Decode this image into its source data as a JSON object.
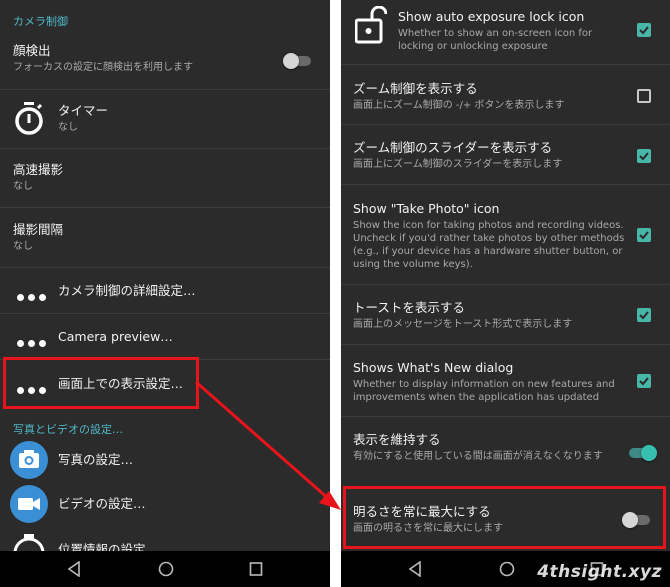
{
  "left": {
    "section_camera_control": "カメラ制御",
    "face_detect": {
      "title": "顔検出",
      "subtitle": "フォーカスの設定に顔検出を利用します",
      "enabled": false
    },
    "timer": {
      "title": "タイマー",
      "subtitle": "なし",
      "icon": "stopwatch-icon"
    },
    "burst": {
      "title": "高速撮影",
      "subtitle": "なし"
    },
    "interval": {
      "title": "撮影間隔",
      "subtitle": "なし"
    },
    "camera_advanced": {
      "title": "カメラ制御の詳細設定…",
      "icon": "more-dots-icon"
    },
    "camera_preview": {
      "title": "Camera preview…",
      "icon": "more-dots-icon"
    },
    "on_screen_gui": {
      "title": "画面上での表示設定…",
      "icon": "more-dots-icon"
    },
    "section_photo_video": "写真とビデオの設定…",
    "photo_settings": {
      "title": "写真の設定…",
      "icon": "camera-icon"
    },
    "video_settings": {
      "title": "ビデオの設定…",
      "icon": "video-camera-icon"
    },
    "location_settings": {
      "title": "位置情報の設定…",
      "icon": "location-icon"
    }
  },
  "right": {
    "auto_exposure_lock": {
      "title": "Show auto exposure lock icon",
      "subtitle": "Whether to show an on-screen icon for locking or unlocking exposure",
      "checked": true,
      "icon": "unlock-icon"
    },
    "zoom_controls": {
      "title": "ズーム制御を表示する",
      "subtitle": "画面上にズーム制御の -/+ ボタンを表示します",
      "checked": false
    },
    "zoom_slider": {
      "title": "ズーム制御のスライダーを表示する",
      "subtitle": "画面上にズーム制御のスライダーを表示します",
      "checked": true
    },
    "take_photo_icon": {
      "title": "Show \"Take Photo\" icon",
      "subtitle": "Show the icon for taking photos and recording videos. Uncheck if you'd rather take photos by other methods (e.g., if your device has a hardware shutter button, or using the volume keys).",
      "checked": true
    },
    "toasts": {
      "title": "トーストを表示する",
      "subtitle": "画面上のメッセージをトースト形式で表示します",
      "checked": true
    },
    "whats_new": {
      "title": "Shows What's New dialog",
      "subtitle": "Whether to display information on new features and improvements when the application has updated",
      "checked": true
    },
    "keep_display_on": {
      "title": "表示を維持する",
      "subtitle": "有効にすると使用している間は画面が消えなくなります",
      "enabled": true
    },
    "max_brightness": {
      "title": "明るさを常に最大にする",
      "subtitle": "画面の明るさを常に最大にします",
      "enabled": false
    }
  },
  "watermark": "4thsight.xyz",
  "colors": {
    "accent": "#4fb8c8",
    "checkbox": "#48b6a8",
    "highlight": "#e8141b",
    "background": "#2b2b2b"
  }
}
